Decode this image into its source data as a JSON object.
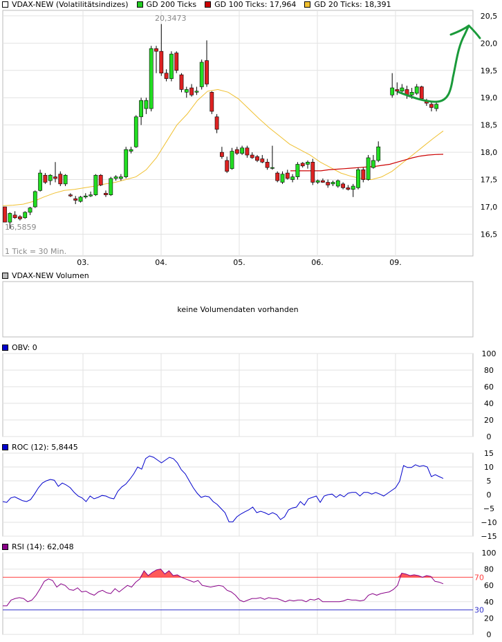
{
  "panels": {
    "main": {
      "legend": [
        {
          "label": "VDAX-NEW (Volatilitätsindizes)",
          "color": "#ffffff"
        },
        {
          "label": "GD 200 Ticks",
          "color": "#22cc22"
        },
        {
          "label": "GD 100 Ticks: 17,964",
          "color": "#cc0000"
        },
        {
          "label": "GD 20 Ticks: 18,391",
          "color": "#f0c030"
        }
      ],
      "yticks": [
        "20,5",
        "20,0",
        "19,5",
        "19,0",
        "18,5",
        "18,0",
        "17,5",
        "17,0",
        "16,5"
      ],
      "xticks": [
        "03.",
        "04.",
        "05.",
        "06.",
        "09."
      ],
      "high_label": "20,3473",
      "low_label": "16,5859",
      "tick_note": "1 Tick = 30 Min."
    },
    "volume": {
      "legend": "VDAX-NEW Volumen",
      "empty_text": "keine Volumendaten vorhanden"
    },
    "obv": {
      "legend": "OBV: 0",
      "yticks": [
        "100",
        "80",
        "60",
        "40",
        "20",
        "0"
      ]
    },
    "roc": {
      "legend": "ROC (12): 5,8445",
      "yticks": [
        "15",
        "10",
        "5",
        "0",
        "−5",
        "−10",
        "−15"
      ]
    },
    "rsi": {
      "legend": "RSI (14): 62,048",
      "yticks": [
        "100",
        "80",
        "60",
        "40",
        "20",
        "0"
      ],
      "upper_label": "70",
      "lower_label": "30"
    }
  },
  "colors": {
    "up": "#22dd22",
    "down": "#dd2222",
    "ma100": "#cc0000",
    "ma20": "#f0c030",
    "roc": "#0000cc",
    "rsi": "#880088",
    "rsi_fill": "#ff5a5a",
    "rsi_upper": "#ff4040",
    "rsi_lower": "#3333cc",
    "annotation": "#1a9a3a"
  },
  "chart_data": [
    {
      "type": "candlestick",
      "ylim": [
        16.1,
        20.6
      ],
      "candles_ohlc": [
        [
          17.0,
          17.0,
          16.72,
          16.72
        ],
        [
          16.72,
          16.9,
          16.6,
          16.88
        ],
        [
          16.85,
          16.92,
          16.78,
          16.8
        ],
        [
          16.82,
          16.85,
          16.75,
          16.78
        ],
        [
          16.8,
          16.92,
          16.78,
          16.9
        ],
        [
          16.9,
          17.0,
          16.85,
          16.98
        ],
        [
          17.0,
          17.3,
          16.98,
          17.28
        ],
        [
          17.3,
          17.68,
          17.28,
          17.62
        ],
        [
          17.58,
          17.62,
          17.42,
          17.45
        ],
        [
          17.48,
          17.6,
          17.4,
          17.58
        ],
        [
          17.55,
          17.82,
          17.45,
          17.52
        ],
        [
          17.6,
          17.65,
          17.38,
          17.42
        ],
        [
          17.42,
          17.6,
          17.38,
          17.58
        ],
        [
          17.22,
          17.25,
          17.18,
          17.2
        ],
        [
          17.15,
          17.2,
          17.05,
          17.12
        ],
        [
          17.1,
          17.2,
          17.08,
          17.18
        ],
        [
          17.18,
          17.25,
          17.15,
          17.2
        ],
        [
          17.2,
          17.28,
          17.18,
          17.22
        ],
        [
          17.22,
          17.6,
          17.2,
          17.58
        ],
        [
          17.58,
          17.6,
          17.38,
          17.4
        ],
        [
          17.25,
          17.3,
          17.18,
          17.22
        ],
        [
          17.22,
          17.55,
          17.2,
          17.52
        ],
        [
          17.52,
          17.58,
          17.48,
          17.55
        ],
        [
          17.52,
          17.6,
          17.48,
          17.55
        ],
        [
          17.55,
          18.1,
          17.52,
          18.05
        ],
        [
          18.02,
          18.1,
          17.98,
          18.05
        ],
        [
          18.1,
          18.68,
          18.08,
          18.65
        ],
        [
          18.65,
          19.0,
          18.5,
          18.95
        ],
        [
          18.8,
          19.0,
          18.7,
          18.95
        ],
        [
          18.8,
          19.95,
          18.75,
          19.9
        ],
        [
          19.9,
          19.95,
          19.45,
          19.85
        ],
        [
          19.85,
          20.35,
          19.4,
          19.45
        ],
        [
          19.45,
          19.52,
          19.3,
          19.35
        ],
        [
          19.35,
          19.85,
          19.3,
          19.8
        ],
        [
          19.82,
          19.85,
          19.45,
          19.5
        ],
        [
          19.42,
          19.45,
          19.1,
          19.15
        ],
        [
          19.1,
          19.2,
          19.0,
          19.15
        ],
        [
          19.18,
          19.25,
          19.02,
          19.05
        ],
        [
          19.1,
          19.2,
          19.05,
          19.12
        ],
        [
          19.2,
          19.7,
          19.15,
          19.65
        ],
        [
          19.68,
          20.05,
          19.2,
          19.25
        ],
        [
          19.1,
          19.12,
          18.7,
          18.75
        ],
        [
          18.65,
          18.7,
          18.35,
          18.42
        ],
        [
          18.0,
          18.1,
          17.88,
          17.92
        ],
        [
          17.85,
          17.92,
          17.62,
          17.65
        ],
        [
          17.7,
          18.08,
          17.68,
          18.02
        ],
        [
          18.05,
          18.1,
          17.95,
          17.98
        ],
        [
          17.98,
          18.12,
          17.95,
          18.08
        ],
        [
          18.08,
          18.12,
          17.9,
          17.95
        ],
        [
          17.95,
          18.0,
          17.88,
          17.9
        ],
        [
          17.92,
          17.95,
          17.82,
          17.85
        ],
        [
          17.88,
          17.95,
          17.8,
          17.82
        ],
        [
          17.82,
          17.88,
          17.68,
          17.72
        ],
        [
          17.72,
          18.12,
          17.68,
          17.72
        ],
        [
          17.62,
          17.65,
          17.45,
          17.48
        ],
        [
          17.45,
          17.65,
          17.42,
          17.6
        ],
        [
          17.62,
          17.68,
          17.5,
          17.52
        ],
        [
          17.5,
          17.6,
          17.45,
          17.55
        ],
        [
          17.55,
          17.82,
          17.5,
          17.78
        ],
        [
          17.8,
          17.82,
          17.72,
          17.75
        ],
        [
          17.78,
          17.85,
          17.7,
          17.82
        ],
        [
          17.82,
          17.88,
          17.4,
          17.45
        ],
        [
          17.45,
          17.5,
          17.42,
          17.48
        ],
        [
          17.48,
          17.52,
          17.44,
          17.45
        ],
        [
          17.45,
          17.5,
          17.35,
          17.4
        ],
        [
          17.42,
          17.48,
          17.38,
          17.45
        ],
        [
          17.38,
          17.5,
          17.35,
          17.48
        ],
        [
          17.42,
          17.45,
          17.32,
          17.35
        ],
        [
          17.35,
          17.4,
          17.3,
          17.32
        ],
        [
          17.32,
          17.42,
          17.18,
          17.38
        ],
        [
          17.35,
          17.72,
          17.32,
          17.68
        ],
        [
          17.68,
          17.72,
          17.45,
          17.5
        ],
        [
          17.5,
          17.95,
          17.48,
          17.9
        ],
        [
          17.72,
          17.95,
          17.7,
          17.85
        ],
        [
          17.85,
          18.2,
          17.82,
          18.1
        ],
        [
          19.05,
          19.45,
          19.0,
          19.18
        ],
        [
          19.15,
          19.28,
          19.05,
          19.12
        ],
        [
          19.12,
          19.25,
          19.08,
          19.18
        ],
        [
          19.15,
          19.22,
          18.98,
          19.05
        ],
        [
          19.05,
          19.18,
          18.98,
          19.1
        ],
        [
          19.08,
          19.25,
          19.05,
          19.2
        ],
        [
          19.2,
          19.22,
          18.95,
          18.98
        ],
        [
          18.95,
          18.98,
          18.85,
          18.9
        ],
        [
          18.88,
          18.92,
          18.75,
          18.82
        ],
        [
          18.8,
          18.92,
          18.75,
          18.88
        ]
      ],
      "ma100": [
        17.66,
        17.66,
        17.66,
        17.66,
        17.66,
        17.68,
        17.69,
        17.7,
        17.71,
        17.72,
        17.73,
        17.74,
        17.76,
        17.78,
        17.82,
        17.86,
        17.9,
        17.93,
        17.95,
        17.96,
        17.964
      ],
      "ma20": [
        17.02,
        17.03,
        17.05,
        17.1,
        17.18,
        17.25,
        17.3,
        17.32,
        17.35,
        17.38,
        17.42,
        17.45,
        17.5,
        17.55,
        17.68,
        17.9,
        18.2,
        18.5,
        18.7,
        18.95,
        19.12,
        19.15,
        19.1,
        18.98,
        18.8,
        18.62,
        18.45,
        18.3,
        18.15,
        18.05,
        17.95,
        17.82,
        17.72,
        17.62,
        17.56,
        17.52,
        17.5,
        17.55,
        17.65,
        17.8,
        17.95,
        18.1,
        18.25,
        18.391
      ]
    },
    {
      "type": "line",
      "name": "ROC (12)",
      "ylim": [
        -15,
        15
      ],
      "values": [
        -2.5,
        -2.8,
        -1.2,
        -0.8,
        -1.5,
        -2.2,
        -2.5,
        -1.8,
        0.2,
        2.5,
        4.2,
        5.0,
        5.5,
        5.2,
        3.0,
        4.2,
        3.5,
        2.5,
        0.8,
        -0.5,
        -1.2,
        -2.5,
        -0.5,
        -1.5,
        -1.0,
        -0.3,
        -0.5,
        -1.2,
        -1.5,
        1.2,
        2.8,
        3.8,
        5.5,
        7.5,
        10.0,
        9.2,
        13.0,
        14.0,
        13.5,
        12.5,
        11.5,
        12.5,
        13.5,
        13.0,
        11.5,
        9.0,
        7.5,
        5.0,
        2.5,
        0.5,
        -1.0,
        -0.5,
        -0.8,
        -2.5,
        -3.5,
        -5.0,
        -6.5,
        -9.8,
        -9.8,
        -8.0,
        -7.0,
        -6.2,
        -5.5,
        -4.5,
        -6.5,
        -6.0,
        -6.5,
        -7.2,
        -6.5,
        -7.2,
        -9.0,
        -8.0,
        -5.5,
        -4.8,
        -4.5,
        -2.5,
        -3.8,
        -1.5,
        -1.0,
        -0.5,
        -2.8,
        -0.5,
        0.0,
        0.2,
        -1.0,
        0.0,
        -0.8,
        0.5,
        0.8,
        0.8,
        -0.5,
        0.8,
        0.8,
        0.2,
        0.8,
        0.2,
        -0.5,
        0.5,
        1.5,
        2.5,
        4.8,
        10.5,
        9.8,
        9.8,
        10.8,
        10.2,
        10.5,
        10.0,
        6.5,
        7.2,
        6.5,
        5.8445
      ]
    },
    {
      "type": "line",
      "name": "RSI (14)",
      "ylim": [
        0,
        100
      ],
      "upper": 70,
      "lower": 30,
      "values": [
        35,
        35,
        42,
        44,
        45,
        44,
        40,
        42,
        48,
        56,
        65,
        68,
        66,
        58,
        62,
        60,
        55,
        54,
        57,
        52,
        53,
        50,
        48,
        52,
        54,
        51,
        50,
        56,
        52,
        56,
        60,
        58,
        64,
        68,
        78,
        72,
        76,
        79,
        80,
        74,
        78,
        72,
        73,
        70,
        68,
        66,
        64,
        66,
        60,
        59,
        58,
        59,
        60,
        59,
        54,
        52,
        48,
        42,
        40,
        42,
        44,
        44,
        45,
        43,
        45,
        44,
        44,
        42,
        40,
        42,
        41,
        42,
        42,
        40,
        43,
        42,
        44,
        40,
        40,
        40,
        40,
        40,
        41,
        43,
        42,
        42,
        41,
        42,
        48,
        50,
        48,
        50,
        51,
        52,
        55,
        60,
        75,
        74,
        72,
        73,
        72,
        70,
        72,
        71,
        65,
        64,
        62.048
      ]
    }
  ]
}
